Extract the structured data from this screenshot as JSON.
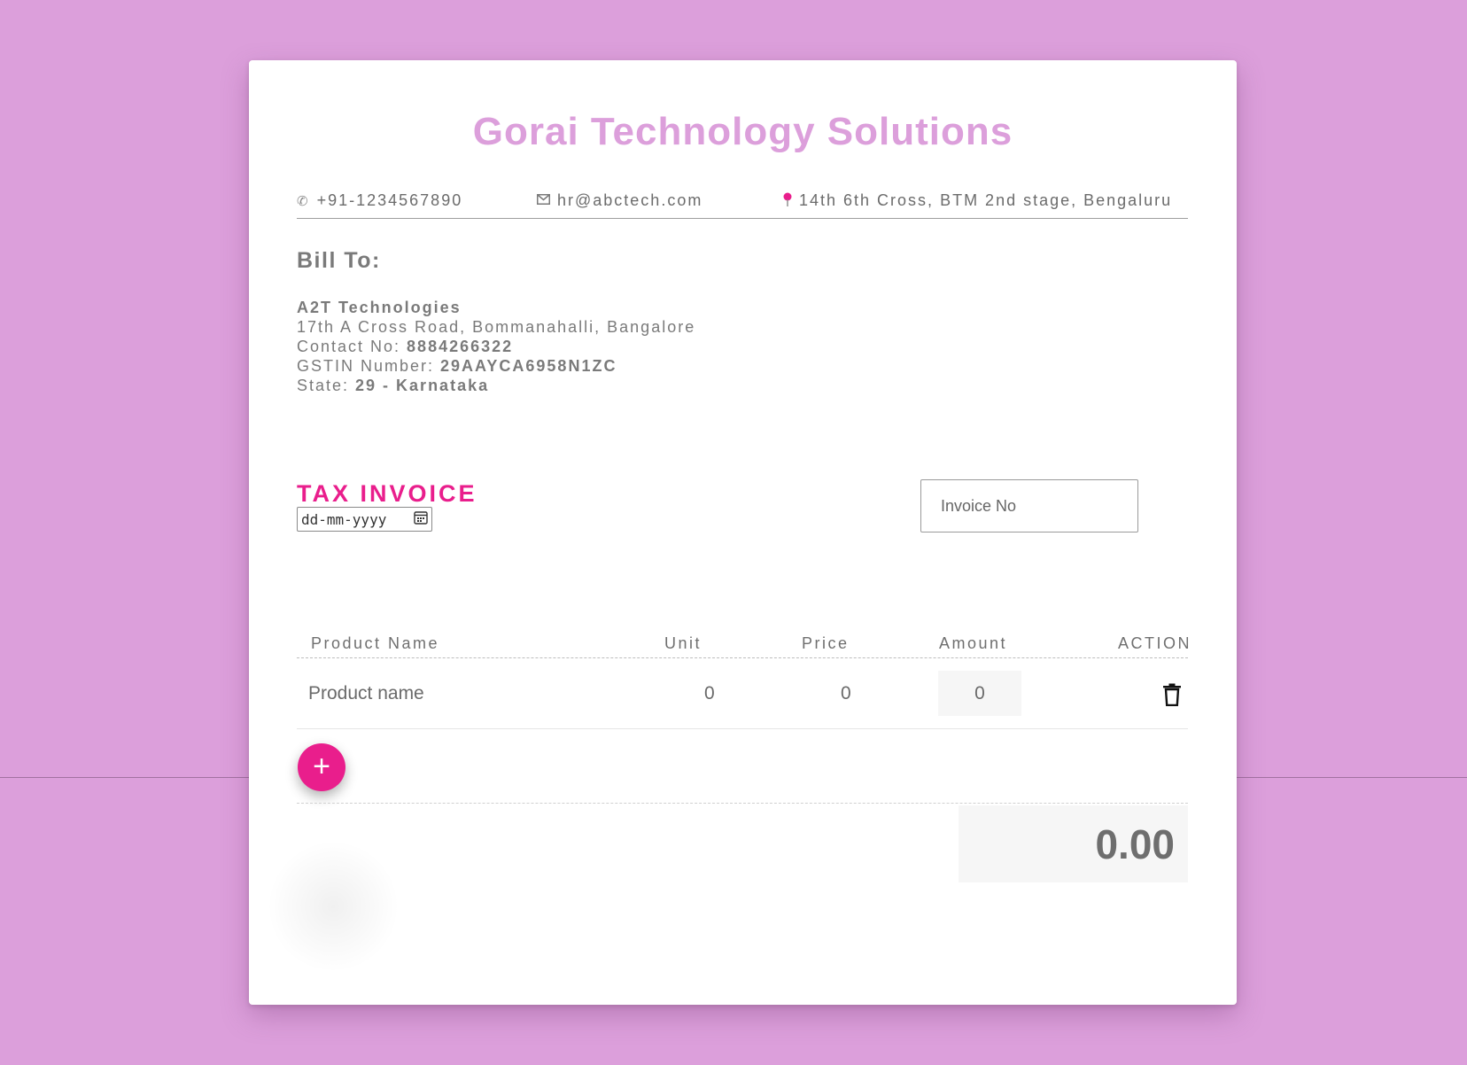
{
  "company": {
    "name": "Gorai Technology Solutions",
    "phone": "+91-1234567890",
    "email": "hr@abctech.com",
    "address": "14th 6th Cross, BTM 2nd stage, Bengaluru"
  },
  "bill_to": {
    "heading": "Bill To:",
    "client_name": "A2T Technologies",
    "client_address": "17th A Cross Road, Bommanahalli, Bangalore",
    "contact_label": "Contact No: ",
    "contact_value": "8884266322",
    "gstin_label": "GSTIN Number: ",
    "gstin_value": "29AAYCA6958N1ZC",
    "state_label": "State: ",
    "state_value": "29 - Karnataka"
  },
  "invoice": {
    "title": "TAX INVOICE",
    "date_placeholder": "dd-mm-yyyy",
    "invoice_no_placeholder": "Invoice No"
  },
  "table": {
    "headers": {
      "product": "Product Name",
      "unit": "Unit",
      "price": "Price",
      "amount": "Amount",
      "action": "ACTION"
    },
    "rows": [
      {
        "product": "Product name",
        "unit": "0",
        "price": "0",
        "amount": "0"
      }
    ]
  },
  "add_button_label": "+",
  "total": "0.00",
  "icons": {
    "phone": "phone-icon",
    "email": "mail-icon",
    "location": "map-pin-icon",
    "calendar": "calendar-icon",
    "delete": "trash-icon",
    "add": "plus-icon"
  },
  "colors": {
    "background": "#dc9fdb",
    "accent": "#e91e8c",
    "title": "#dc9fdb"
  }
}
